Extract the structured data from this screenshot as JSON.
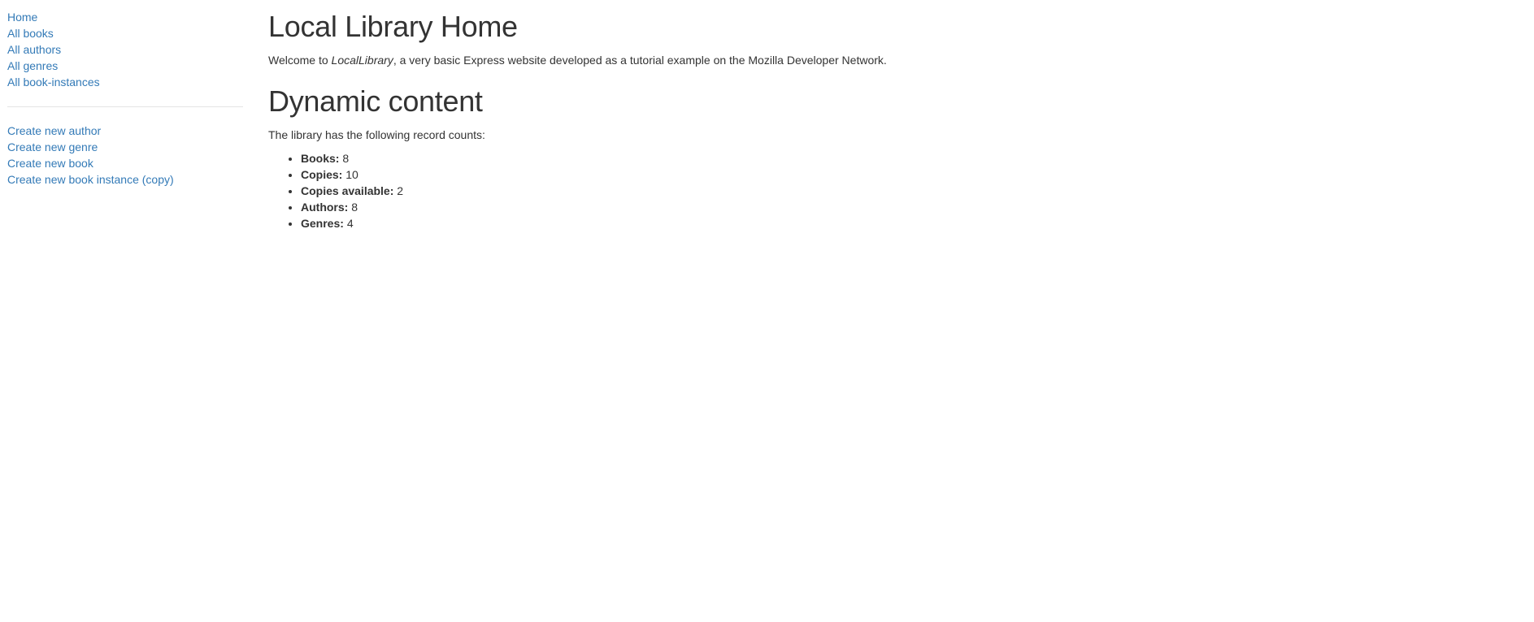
{
  "sidebar": {
    "nav": [
      {
        "label": "Home"
      },
      {
        "label": "All books"
      },
      {
        "label": "All authors"
      },
      {
        "label": "All genres"
      },
      {
        "label": "All book-instances"
      }
    ],
    "create": [
      {
        "label": "Create new author"
      },
      {
        "label": "Create new genre"
      },
      {
        "label": "Create new book"
      },
      {
        "label": "Create new book instance (copy)"
      }
    ]
  },
  "main": {
    "title": "Local Library Home",
    "welcome": {
      "prefix": "Welcome to ",
      "emphasis": "LocalLibrary",
      "suffix": ", a very basic Express website developed as a tutorial example on the Mozilla Developer Network."
    },
    "dynamic_heading": "Dynamic content",
    "counts_intro": "The library has the following record counts:",
    "counts": [
      {
        "label": "Books:",
        "value": "8"
      },
      {
        "label": "Copies:",
        "value": "10"
      },
      {
        "label": "Copies available:",
        "value": "2"
      },
      {
        "label": "Authors:",
        "value": "8"
      },
      {
        "label": "Genres:",
        "value": "4"
      }
    ]
  },
  "colors": {
    "link": "#337ab7",
    "text": "#333333",
    "divider": "#e5e5e5"
  }
}
